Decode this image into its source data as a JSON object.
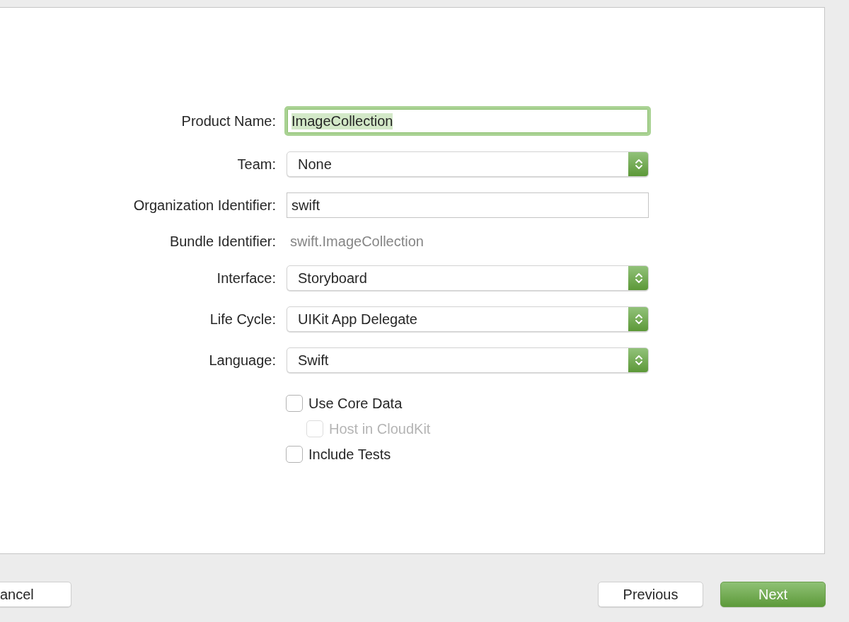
{
  "form": {
    "fields": [
      {
        "kind": "text",
        "label": "Product Name:",
        "value": "ImageCollection",
        "focused": true,
        "selected_text": true
      },
      {
        "kind": "popup",
        "label": "Team:",
        "value": "None"
      },
      {
        "kind": "text",
        "label": "Organization Identifier:",
        "value": "swift",
        "focused": false,
        "selected_text": false
      },
      {
        "kind": "static",
        "label": "Bundle Identifier:",
        "value": "swift.ImageCollection"
      },
      {
        "kind": "popup",
        "label": "Interface:",
        "value": "Storyboard"
      },
      {
        "kind": "popup",
        "label": "Life Cycle:",
        "value": "UIKit App Delegate"
      },
      {
        "kind": "popup",
        "label": "Language:",
        "value": "Swift"
      }
    ],
    "checkboxes": [
      {
        "label": "Use Core Data",
        "checked": false,
        "disabled": false,
        "children": [
          {
            "label": "Host in CloudKit",
            "checked": false,
            "disabled": true
          }
        ]
      },
      {
        "label": "Include Tests",
        "checked": false,
        "disabled": false
      }
    ]
  },
  "left_buttons": [
    {
      "label": "ancel",
      "default": false
    }
  ],
  "right_buttons": [
    {
      "label": "Previous",
      "default": false
    },
    {
      "label": "Next",
      "default": true
    }
  ]
}
